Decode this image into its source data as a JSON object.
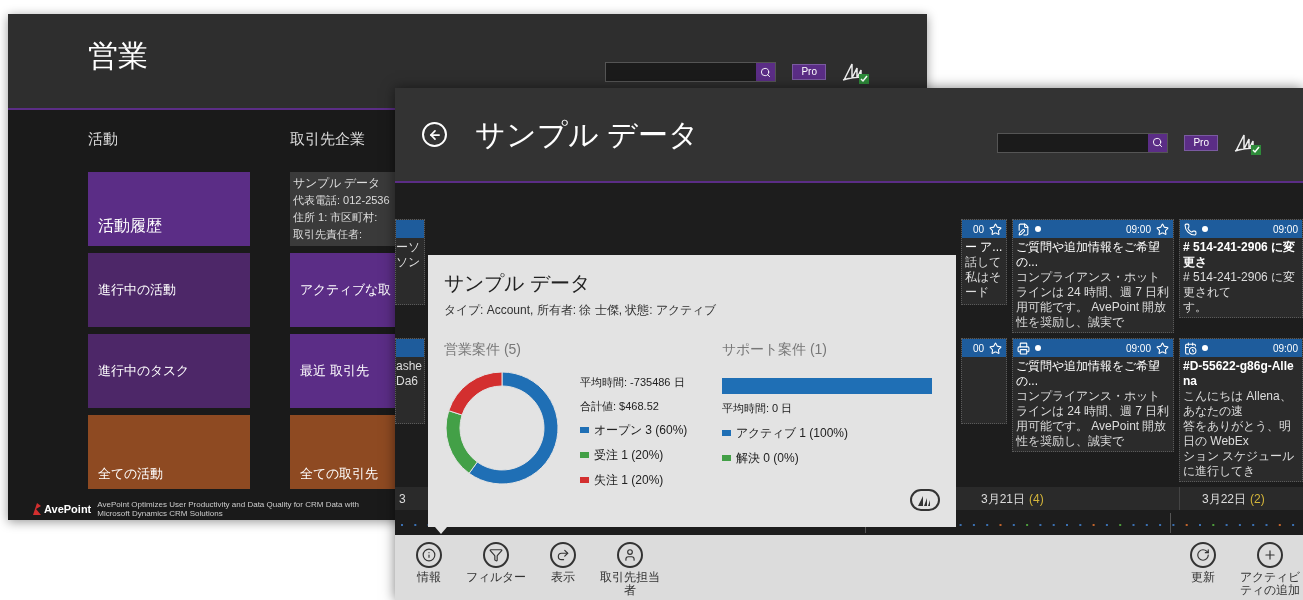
{
  "back_window": {
    "title": "営業",
    "pro_badge": "Pro",
    "columns": [
      {
        "heading": "活動",
        "items": [
          {
            "kind": "large",
            "label": "活動履歴",
            "color": "#5b2d86"
          },
          {
            "kind": "medium",
            "label": "進行中の活動",
            "color": "#4d2768"
          },
          {
            "kind": "medium",
            "label": "進行中のタスク",
            "color": "#4d2768"
          },
          {
            "kind": "bottom",
            "label": "全ての活動",
            "color": "#8e4a22"
          }
        ]
      },
      {
        "heading": "取引先企業",
        "items": [
          {
            "kind": "card",
            "title": "サンプル データ",
            "lines": [
              "代表電話: 012-2536",
              "住所 1: 市区町村:",
              "取引先責任者:"
            ]
          },
          {
            "kind": "medium",
            "label": "アクティブな取",
            "color": "#5b2d86"
          },
          {
            "kind": "medium",
            "label": "最近 取引先",
            "color": "#5b2d86"
          },
          {
            "kind": "bottom",
            "label": "全ての取引先",
            "color": "#8e4a22"
          }
        ]
      }
    ],
    "footer": {
      "brand": "AvePoint",
      "lines": [
        "AvePoint Optimizes User Productivity and Data Quality for CRM Data with",
        "Microsoft Dynamics CRM Solutions"
      ]
    }
  },
  "front_window": {
    "title": "サンプル データ",
    "pro_badge": "Pro",
    "card_columns": [
      {
        "kind": "edge",
        "cards": [
          {
            "lines": [
              "ーソ",
              "ソン"
            ]
          },
          {
            "lines": [
              "ashe",
              "Da6"
            ]
          }
        ]
      },
      {
        "kind": "partial",
        "cards": [
          {
            "time": "00",
            "title": "ー ア...",
            "lines": [
              "話して",
              "私はそ",
              "ード"
            ]
          },
          {
            "time": "00"
          }
        ]
      },
      {
        "kind": "full",
        "cards": [
          {
            "kind": "note",
            "time": "09:00",
            "title": "ご質問や追加情報をご希望の...",
            "body": "コンプライアンス・ホットラインは 24 時間、週 7 日利用可能です。 AvePoint 開放性を奨励し、誠実で"
          },
          {
            "kind": "fax",
            "time": "09:00",
            "title": "ご質問や追加情報をご希望の...",
            "body": "コンプライアンス・ホットラインは 24 時間、週 7 日利用可能です。 AvePoint 開放性を奨励し、誠実で"
          }
        ]
      },
      {
        "kind": "cut",
        "cards": [
          {
            "kind": "phone",
            "time": "09:00",
            "title": "# 514-241-2906 に変更さ",
            "lines": [
              "# 514-241-2906 に変更されて",
              "す。"
            ]
          },
          {
            "kind": "calendar",
            "time": "09:00",
            "title": "#D-55622-g86g-Allena",
            "lines": [
              "こんにちは Allena、あなたの速",
              "答をありがとう、明日の WebEx",
              "ション スケジュールに進行してき"
            ]
          }
        ]
      }
    ],
    "dates": [
      {
        "label": "3"
      },
      {
        "label": "3月21日",
        "count": "(4)"
      },
      {
        "label": "3月22日",
        "count": "(2)"
      }
    ],
    "popup": {
      "title": "サンプル データ",
      "subtitle": "タイプ: Account, 所有者: 徐 士傑, 状態: アクティブ",
      "sales": {
        "heading": "営業案件 (5)",
        "stats": [
          "平均時間: -735486 日",
          "合計値: $468.52"
        ],
        "legend": [
          {
            "color": "#1f6fb5"
          },
          {
            "color": "#43a047"
          },
          {
            "color": "#d32f2f"
          }
        ],
        "chart_data": {
          "type": "donut",
          "categories": [
            "オープン 3 (60%)",
            "受注 1 (20%)",
            "失注 1 (20%)"
          ],
          "values": [
            3,
            1,
            1
          ]
        }
      },
      "support": {
        "heading": "サポート案件 (1)",
        "bar": {
          "level": 1
        },
        "stats": [
          "平均時間: 0 日"
        ],
        "legend": [
          {
            "label": "アクティブ 1 (100%)",
            "color": "#1f6fb5"
          },
          {
            "label": "解決 0 (0%)",
            "color": "#43a047"
          }
        ]
      }
    },
    "app_bar": {
      "left": [
        {
          "kind": "info",
          "label": "情報"
        },
        {
          "kind": "filter",
          "label": "フィルター"
        },
        {
          "kind": "redo",
          "label": "表示"
        },
        {
          "kind": "person",
          "label": "取引先担当者"
        }
      ],
      "right": [
        {
          "kind": "refresh",
          "label": "更新"
        },
        {
          "kind": "plus",
          "label": "アクティビティの追加"
        }
      ]
    }
  }
}
